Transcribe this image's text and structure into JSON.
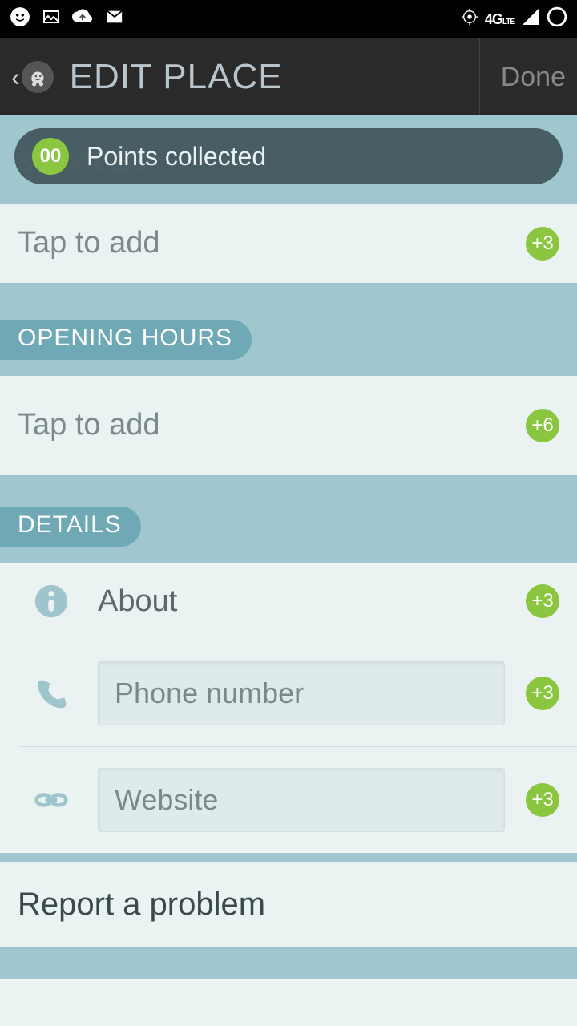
{
  "header": {
    "title": "EDIT PLACE",
    "done": "Done"
  },
  "toast": {
    "points_value": "00",
    "points_label": "Points collected"
  },
  "sections": {
    "services": {
      "label": "SERVICES",
      "placeholder": "Tap to add",
      "bonus": "+3"
    },
    "opening_hours": {
      "label": "OPENING HOURS",
      "placeholder": "Tap to add",
      "bonus": "+6"
    },
    "details": {
      "label": "DETAILS",
      "about": {
        "label": "About",
        "bonus": "+3"
      },
      "phone": {
        "placeholder": "Phone number",
        "bonus": "+3"
      },
      "website": {
        "placeholder": "Website",
        "bonus": "+3"
      }
    }
  },
  "report": "Report a problem"
}
